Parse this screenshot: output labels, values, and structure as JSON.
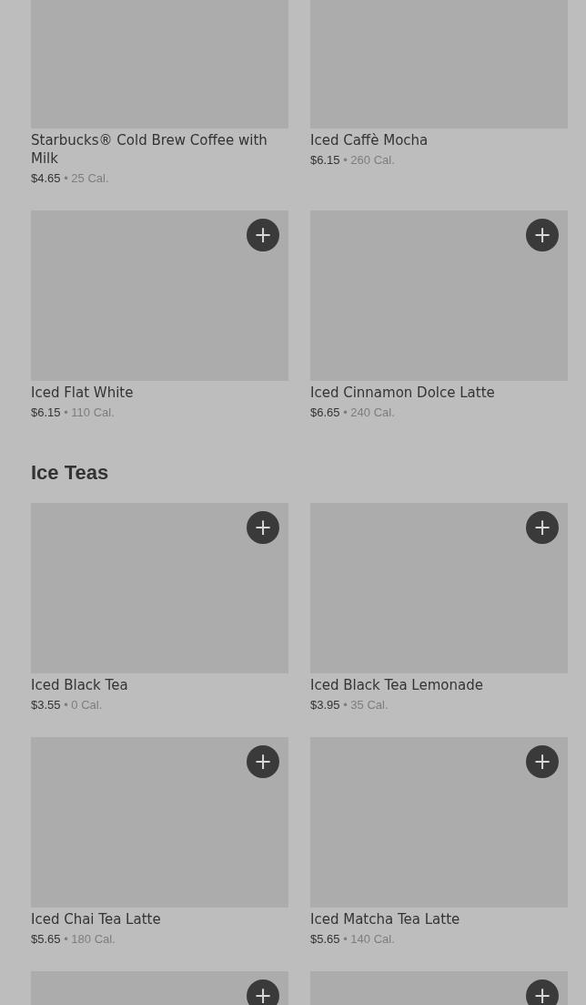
{
  "sections": [
    {
      "items": [
        {
          "name": "Starbucks® Cold Brew Coffee with Milk",
          "price": "$4.65",
          "separator": "•",
          "calories": "25 Cal.",
          "add_button": false
        },
        {
          "name": "Iced Caffè Mocha",
          "price": "$6.15",
          "separator": "•",
          "calories": "260 Cal.",
          "add_button": false
        },
        {
          "name": "Iced Flat White",
          "price": "$6.15",
          "separator": "•",
          "calories": "110 Cal.",
          "add_button": true,
          "add_label": "+"
        },
        {
          "name": "Iced Cinnamon Dolce Latte",
          "price": "$6.65",
          "separator": "•",
          "calories": "240 Cal.",
          "add_button": true,
          "add_label": "+"
        }
      ]
    },
    {
      "title": "Ice Teas",
      "items": [
        {
          "name": "Iced Black Tea",
          "price": "$3.55",
          "separator": "•",
          "calories": "0 Cal.",
          "add_button": true,
          "add_label": "+"
        },
        {
          "name": "Iced Black Tea Lemonade",
          "price": "$3.95",
          "separator": "•",
          "calories": "35 Cal.",
          "add_button": true,
          "add_label": "+"
        },
        {
          "name": "Iced Chai Tea Latte",
          "price": "$5.65",
          "separator": "•",
          "calories": "180 Cal.",
          "add_button": true,
          "add_label": "+"
        },
        {
          "name": "Iced Matcha Tea Latte",
          "price": "$5.65",
          "separator": "•",
          "calories": "140 Cal.",
          "add_button": true,
          "add_label": "+"
        },
        {
          "add_button": true,
          "add_label": "+"
        },
        {
          "add_button": true,
          "add_label": "+"
        }
      ]
    }
  ]
}
